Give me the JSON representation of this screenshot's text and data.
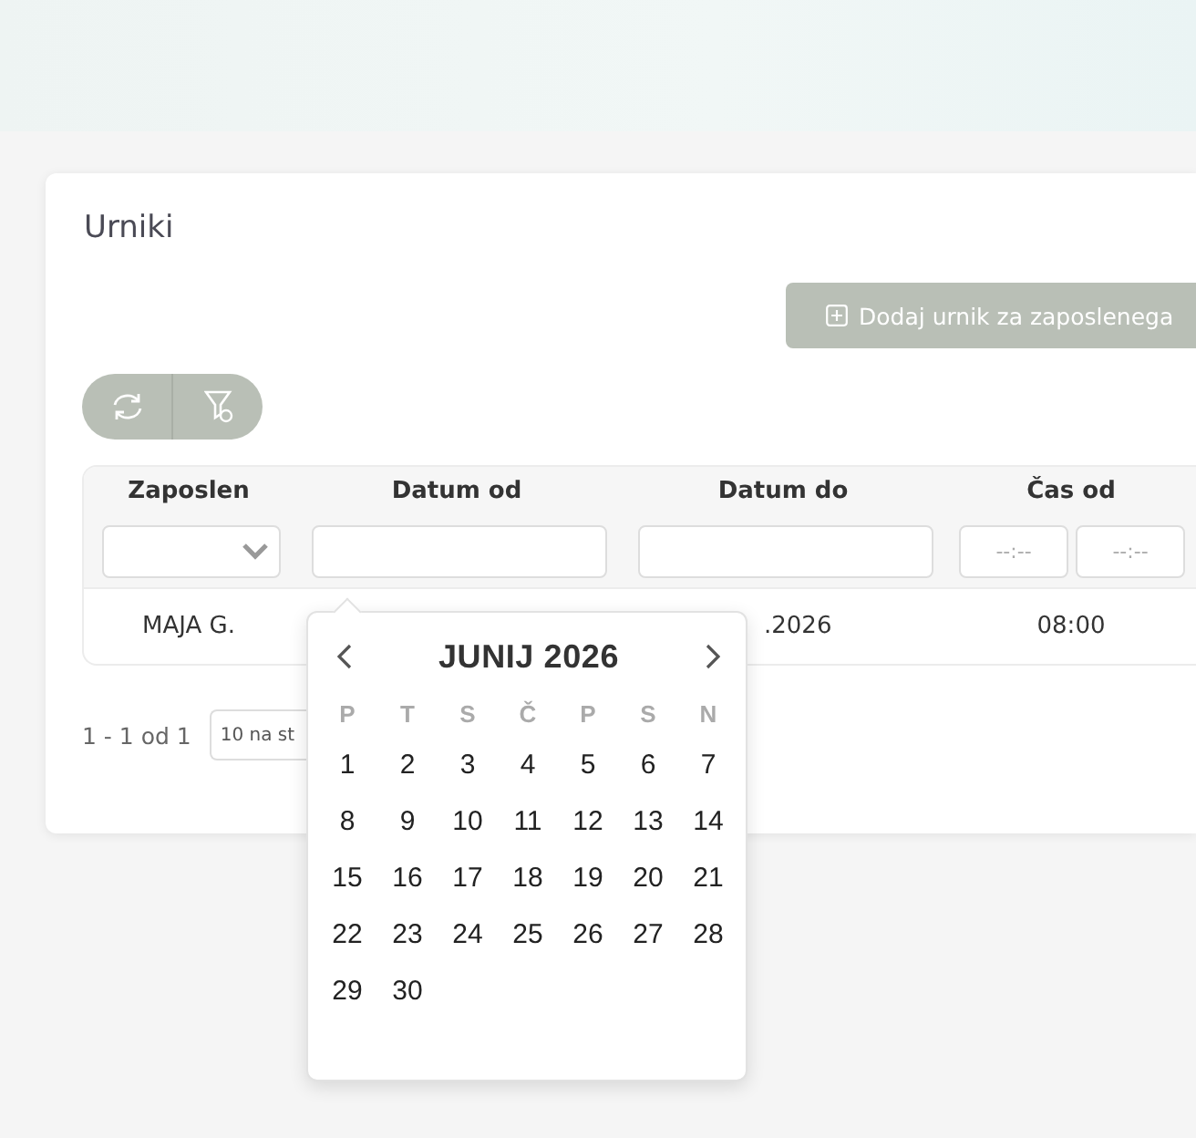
{
  "card": {
    "title": "Urniki",
    "add_button": {
      "label": "Dodaj urnik za zaposlenega"
    }
  },
  "table": {
    "columns": [
      "Zaposlen",
      "Datum od",
      "Datum do",
      "Čas od"
    ],
    "filters": {
      "time_from_placeholder": "--:--",
      "time_to_placeholder": "--:--"
    },
    "rows": [
      {
        "employee": "MAJA G.",
        "date_to": ".2026",
        "time_from": "08:00"
      }
    ]
  },
  "pagination": {
    "range": "1 - 1 od 1",
    "page_size": "10 na st"
  },
  "datepicker": {
    "title": "JUNIJ 2026",
    "weekdays": [
      "P",
      "T",
      "S",
      "Č",
      "P",
      "S",
      "N"
    ],
    "days": [
      "1",
      "2",
      "3",
      "4",
      "5",
      "6",
      "7",
      "8",
      "9",
      "10",
      "11",
      "12",
      "13",
      "14",
      "15",
      "16",
      "17",
      "18",
      "19",
      "20",
      "21",
      "22",
      "23",
      "24",
      "25",
      "26",
      "27",
      "28",
      "29",
      "30"
    ]
  }
}
